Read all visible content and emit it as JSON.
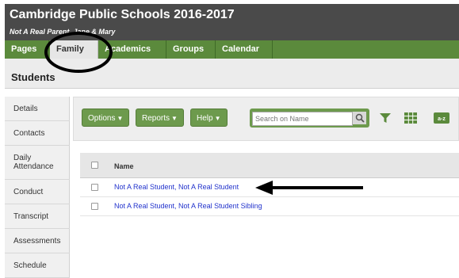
{
  "header": {
    "title": "Cambridge Public Schools 2016-2017",
    "subtitle": "Not A Real Parent, Jane & Mary"
  },
  "nav": {
    "tabs": [
      {
        "label": "Pages"
      },
      {
        "label": "Family",
        "active": true
      },
      {
        "label": "Academics"
      },
      {
        "label": "Groups"
      },
      {
        "label": "Calendar"
      }
    ]
  },
  "page": {
    "title": "Students"
  },
  "sidebar": {
    "items": [
      {
        "label": "Details"
      },
      {
        "label": "Contacts"
      },
      {
        "label": "Daily Attendance"
      },
      {
        "label": "Conduct"
      },
      {
        "label": "Transcript"
      },
      {
        "label": "Assessments"
      },
      {
        "label": "Schedule"
      }
    ]
  },
  "toolbar": {
    "options_label": "Options",
    "reports_label": "Reports",
    "help_label": "Help",
    "search_placeholder": "Search on Name",
    "icons": [
      "search-icon",
      "filter-icon",
      "grid-icon",
      "sort-az-icon"
    ]
  },
  "table": {
    "column_header": "Name",
    "rows": [
      {
        "name": "Not A Real Student, Not A Real Student"
      },
      {
        "name": "Not A Real Student, Not A Real Student Sibling"
      }
    ]
  },
  "colors": {
    "brand_green": "#5b8a3c",
    "button_green": "#6d9a4d",
    "header_dark": "#4a4a4a",
    "link_blue": "#2233cc"
  }
}
